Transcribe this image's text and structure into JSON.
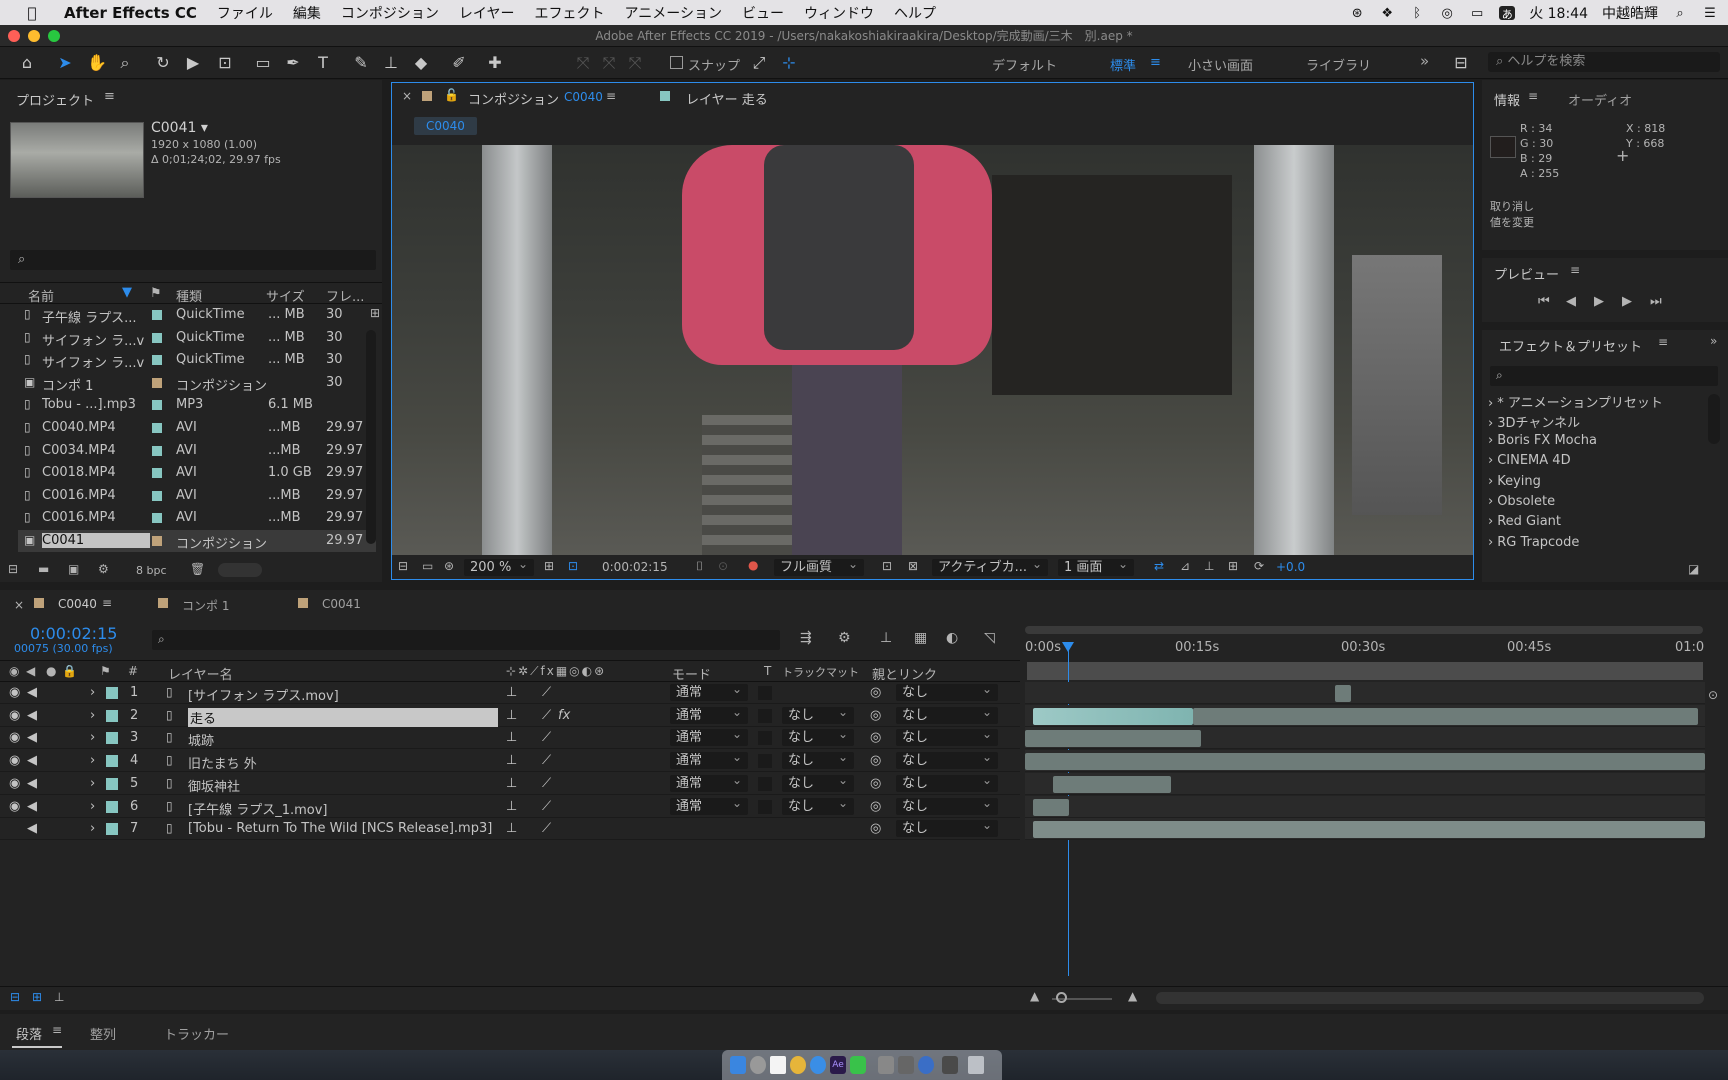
{
  "menubar": {
    "app_name": "After Effects CC",
    "items": [
      "ファイル",
      "編集",
      "コンポジション",
      "レイヤー",
      "エフェクト",
      "アニメーション",
      "ビュー",
      "ウィンドウ",
      "ヘルプ"
    ],
    "clock": "火 18:44",
    "user": "中越皓輝"
  },
  "window_title": "Adobe After Effects CC 2019 - /Users/nakakoshiakiraakira/Desktop/完成動画/三木　別.aep *",
  "toolbar": {
    "snap_label": "スナップ",
    "workspaces": [
      "デフォルト",
      "標準",
      "小さい画面",
      "ライブラリ"
    ],
    "active_workspace": "標準",
    "help_placeholder": "ヘルプを検索"
  },
  "project": {
    "title": "プロジェクト",
    "selected_name": "C0041 ▾",
    "selected_dims": "1920 x 1080 (1.00)",
    "selected_duration": "Δ 0;01;24;02, 29.97 fps",
    "columns": {
      "name": "名前",
      "type": "種類",
      "size": "サイズ",
      "frame": "フレ..."
    },
    "items": [
      {
        "name": "子午線 ラプス...",
        "type": "QuickTime",
        "size": "... MB",
        "fps": "30",
        "color": "#87c6c1"
      },
      {
        "name": "サイフォン ラ...v",
        "type": "QuickTime",
        "size": "... MB",
        "fps": "30",
        "color": "#87c6c1"
      },
      {
        "name": "サイフォン ラ...v",
        "type": "QuickTime",
        "size": "... MB",
        "fps": "30",
        "color": "#87c6c1"
      },
      {
        "name": "コンポ 1",
        "type": "コンポジション",
        "size": "",
        "fps": "30",
        "color": "#bfa27a"
      },
      {
        "name": "Tobu - ...].mp3",
        "type": "MP3",
        "size": "6.1 MB",
        "fps": "",
        "color": "#87c6c1"
      },
      {
        "name": "C0040.MP4",
        "type": "AVI",
        "size": "...MB",
        "fps": "29.97",
        "color": "#87c6c1"
      },
      {
        "name": "C0034.MP4",
        "type": "AVI",
        "size": "...MB",
        "fps": "29.97",
        "color": "#87c6c1"
      },
      {
        "name": "C0018.MP4",
        "type": "AVI",
        "size": "1.0 GB",
        "fps": "29.97",
        "color": "#87c6c1"
      },
      {
        "name": "C0016.MP4",
        "type": "AVI",
        "size": "...MB",
        "fps": "29.97",
        "color": "#87c6c1"
      },
      {
        "name": "C0016.MP4",
        "type": "AVI",
        "size": "...MB",
        "fps": "29.97",
        "color": "#87c6c1"
      },
      {
        "name": "C0041",
        "type": "コンポジション",
        "size": "",
        "fps": "29.97",
        "color": "#bfa27a"
      }
    ],
    "bpc": "8 bpc"
  },
  "composition": {
    "tab_label": "コンポジション",
    "tab_comp": "C0040",
    "layer_tab": "レイヤー 走る",
    "sub_tab": "C0040",
    "zoom": "200 %",
    "timecode": "0:00:02:15",
    "quality": "フル画質",
    "camera": "アクティブカ...",
    "views": "1 画面",
    "exposure": "+0.0"
  },
  "info": {
    "tab": "情報",
    "tab2": "オーディオ",
    "r": "R : 34",
    "g": "G : 30",
    "b": "B : 29",
    "a": "A : 255",
    "x": "X : 818",
    "y": "Y : 668",
    "undo1": "取り消し",
    "undo2": "値を変更",
    "swatch": "#221e1d"
  },
  "preview": {
    "title": "プレビュー"
  },
  "effects": {
    "title": "エフェクト＆プリセット",
    "items": [
      "* アニメーションプリセット",
      "3Dチャンネル",
      "Boris FX Mocha",
      "CINEMA 4D",
      "Keying",
      "Obsolete",
      "Red Giant",
      "RG Trapcode"
    ]
  },
  "timeline": {
    "tabs": [
      "C0040",
      "コンポ 1",
      "C0041"
    ],
    "timecode": "0:00:02:15",
    "frames": "00075 (30.00 fps)",
    "col_layer_name": "レイヤー名",
    "col_mode": "モード",
    "col_t": "T",
    "col_track": "トラックマット",
    "col_parent": "親とリンク",
    "ruler": [
      "0:00s",
      "00:15s",
      "00:30s",
      "00:45s",
      "01:0"
    ],
    "layers": [
      {
        "num": "1",
        "name": "[サイフォン ラプス.mov]",
        "mode": "通常",
        "track": "",
        "parent": "なし",
        "fx": false
      },
      {
        "num": "2",
        "name": "走る",
        "mode": "通常",
        "track": "なし",
        "parent": "なし",
        "fx": true
      },
      {
        "num": "3",
        "name": "城跡",
        "mode": "通常",
        "track": "なし",
        "parent": "なし",
        "fx": false
      },
      {
        "num": "4",
        "name": "旧たまち 外",
        "mode": "通常",
        "track": "なし",
        "parent": "なし",
        "fx": false
      },
      {
        "num": "5",
        "name": "御坂神社",
        "mode": "通常",
        "track": "なし",
        "parent": "なし",
        "fx": false
      },
      {
        "num": "6",
        "name": "[子午線 ラプス_1.mov]",
        "mode": "通常",
        "track": "なし",
        "parent": "なし",
        "fx": false
      },
      {
        "num": "7",
        "name": "[Tobu - Return To The Wild [NCS Release].mp3]",
        "mode": "",
        "track": "",
        "parent": "なし",
        "fx": false
      }
    ]
  },
  "bottom_tabs": [
    "段落",
    "整列",
    "トラッカー"
  ]
}
